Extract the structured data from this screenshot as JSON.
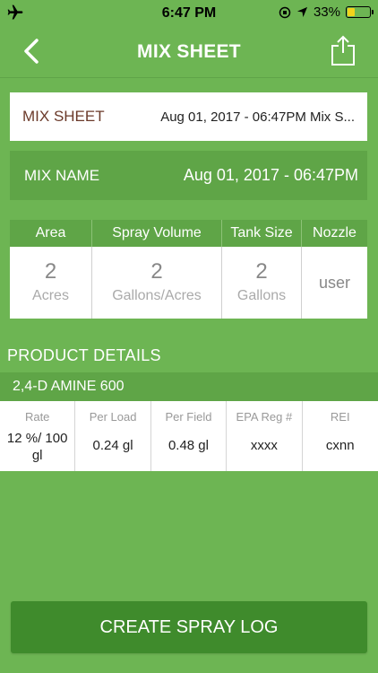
{
  "status_bar": {
    "time": "6:47 PM",
    "battery": "33%",
    "battery_level": 0.33
  },
  "nav": {
    "title": "MIX SHEET"
  },
  "mix_sheet": {
    "label": "MIX SHEET",
    "value": "Aug 01, 2017 - 06:47PM Mix S..."
  },
  "mix_name": {
    "label": "MIX NAME",
    "value": "Aug 01, 2017 - 06:47PM"
  },
  "summary": {
    "headers": [
      "Area",
      "Spray Volume",
      "Tank Size",
      "Nozzle"
    ],
    "area": {
      "value": "2",
      "unit": "Acres"
    },
    "spray_volume": {
      "value": "2",
      "unit": "Gallons/Acres"
    },
    "tank_size": {
      "value": "2",
      "unit": "Gallons"
    },
    "nozzle": "user"
  },
  "product_details": {
    "title": "PRODUCT DETAILS",
    "product_name": "2,4-D AMINE 600",
    "headers": [
      "Rate",
      "Per Load",
      "Per Field",
      "EPA Reg #",
      "REI"
    ],
    "values": {
      "rate": "12 %/ 100 gl",
      "per_load": "0.24 gl",
      "per_field": "0.48 gl",
      "epa_reg": "xxxx",
      "rei": "cxnn"
    }
  },
  "actions": {
    "create_spray_log": "CREATE SPRAY LOG"
  },
  "colors": {
    "background": "#6db553",
    "dark_green": "#3f8b2c",
    "header_green": "#5fa547",
    "label_brown": "#6b3a2a"
  }
}
